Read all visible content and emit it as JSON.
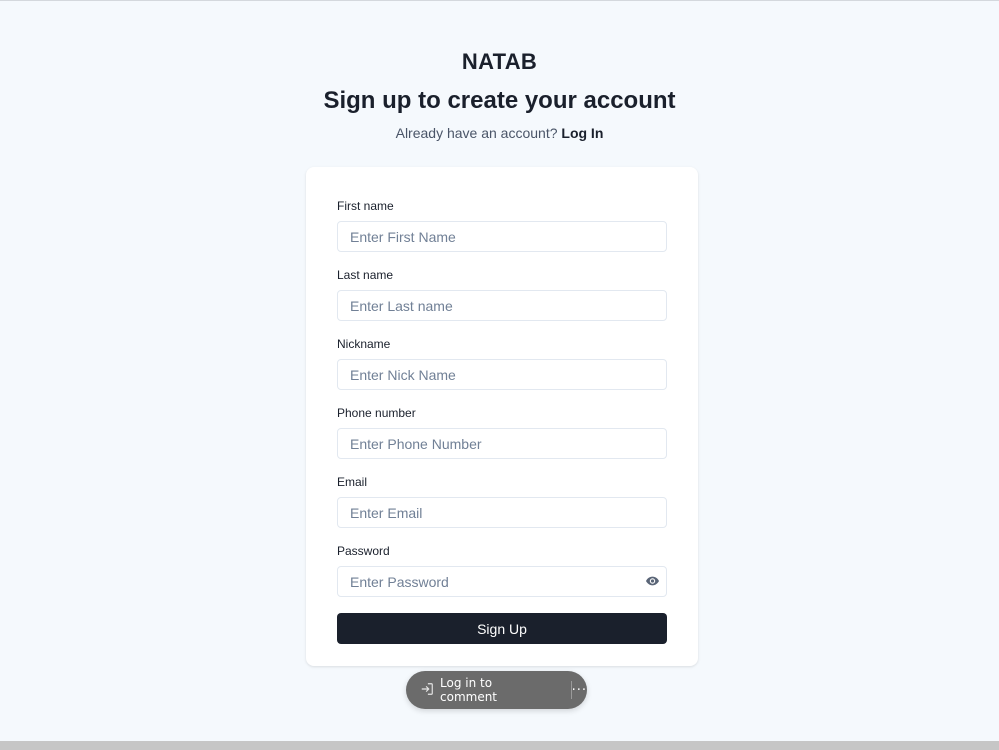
{
  "header": {
    "brand": "NATAB",
    "title": "Sign up to create your account",
    "prompt": "Already have an account?",
    "login_link": "Log In"
  },
  "form": {
    "fields": [
      {
        "label": "First name",
        "placeholder": "Enter First Name"
      },
      {
        "label": "Last name",
        "placeholder": "Enter Last name"
      },
      {
        "label": "Nickname",
        "placeholder": "Enter Nick Name"
      },
      {
        "label": "Phone number",
        "placeholder": "Enter Phone Number"
      },
      {
        "label": "Email",
        "placeholder": "Enter Email"
      },
      {
        "label": "Password",
        "placeholder": "Enter Password",
        "icon": "eye-icon"
      }
    ],
    "submit_label": "Sign Up"
  },
  "comment_bar": {
    "login_label": "Log in to comment",
    "login_icon": "login-arrow-icon",
    "more_icon": "more-dots-icon",
    "more_label": "···"
  },
  "colors": {
    "background": "#f5f9fd",
    "primary": "#1a202c",
    "pill": "#6b6b6b"
  }
}
